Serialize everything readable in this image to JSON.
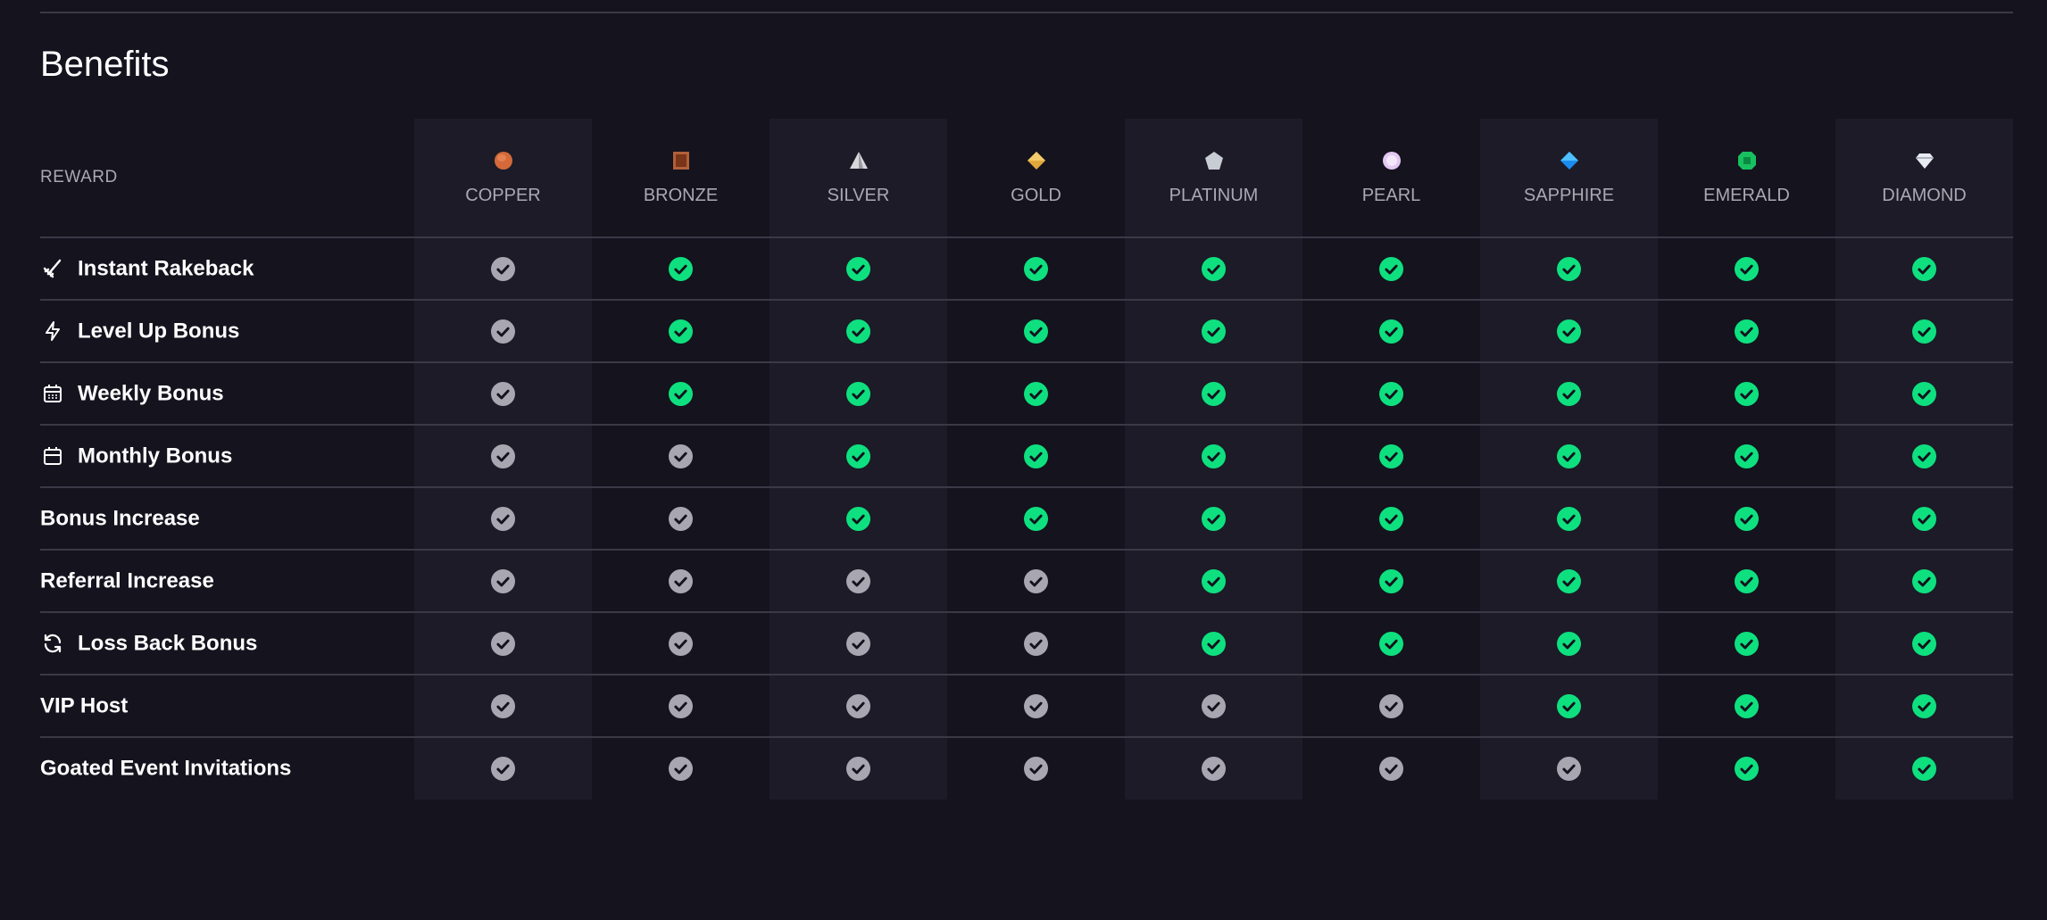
{
  "title": "Benefits",
  "header": {
    "reward_label": "REWARD"
  },
  "colors": {
    "check_on": "#0ee07f",
    "check_off": "#a8a7b1",
    "background": "#14131e",
    "shade": "#1c1b27"
  },
  "tiers": [
    {
      "name": "COPPER",
      "icon": "copper-coin-icon",
      "color": "#d4693a"
    },
    {
      "name": "BRONZE",
      "icon": "bronze-bar-icon",
      "color": "#b0603a"
    },
    {
      "name": "SILVER",
      "icon": "silver-pyramid-icon",
      "color": "#d8d8dc"
    },
    {
      "name": "GOLD",
      "icon": "gold-diamond-icon",
      "color": "#e0a83c"
    },
    {
      "name": "PLATINUM",
      "icon": "platinum-pentagon-icon",
      "color": "#c8ccd4"
    },
    {
      "name": "PEARL",
      "icon": "pearl-icon",
      "color": "#e3c8f2"
    },
    {
      "name": "SAPPHIRE",
      "icon": "sapphire-gem-icon",
      "color": "#1a8cf0"
    },
    {
      "name": "EMERALD",
      "icon": "emerald-gem-icon",
      "color": "#18c060"
    },
    {
      "name": "DIAMOND",
      "icon": "diamond-gem-icon",
      "color": "#e8ecf2"
    }
  ],
  "rows": [
    {
      "label": "Instant Rakeback",
      "icon": "rake-icon",
      "available": [
        false,
        true,
        true,
        true,
        true,
        true,
        true,
        true,
        true
      ]
    },
    {
      "label": "Level Up Bonus",
      "icon": "lightning-icon",
      "available": [
        false,
        true,
        true,
        true,
        true,
        true,
        true,
        true,
        true
      ]
    },
    {
      "label": "Weekly Bonus",
      "icon": "calendar-grid-icon",
      "available": [
        false,
        true,
        true,
        true,
        true,
        true,
        true,
        true,
        true
      ]
    },
    {
      "label": "Monthly Bonus",
      "icon": "calendar-icon",
      "available": [
        false,
        false,
        true,
        true,
        true,
        true,
        true,
        true,
        true
      ]
    },
    {
      "label": "Bonus Increase",
      "icon": "",
      "available": [
        false,
        false,
        true,
        true,
        true,
        true,
        true,
        true,
        true
      ]
    },
    {
      "label": "Referral Increase",
      "icon": "",
      "available": [
        false,
        false,
        false,
        false,
        true,
        true,
        true,
        true,
        true
      ]
    },
    {
      "label": "Loss Back Bonus",
      "icon": "refresh-icon",
      "available": [
        false,
        false,
        false,
        false,
        true,
        true,
        true,
        true,
        true
      ]
    },
    {
      "label": "VIP Host",
      "icon": "",
      "available": [
        false,
        false,
        false,
        false,
        false,
        false,
        true,
        true,
        true
      ]
    },
    {
      "label": "Goated Event Invitations",
      "icon": "",
      "available": [
        false,
        false,
        false,
        false,
        false,
        false,
        false,
        true,
        true
      ]
    }
  ]
}
